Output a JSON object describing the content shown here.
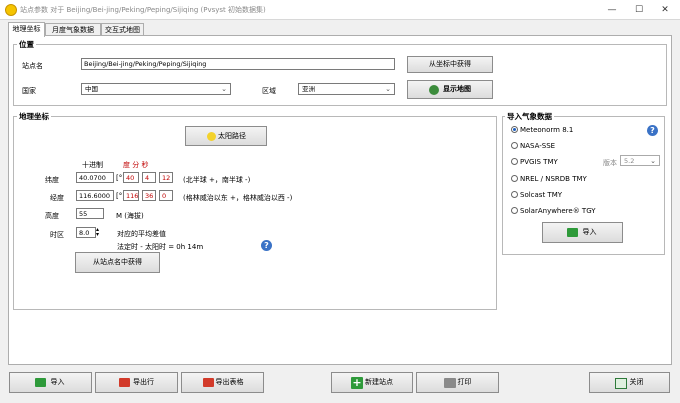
{
  "window": {
    "title": "站点参数 对于 Beijing/Bei-jing/Peking/Peping/Sijiqing (Pvsyst 初始数据集)",
    "minimize": "—",
    "maximize": "☐",
    "close": "✕"
  },
  "tabs": [
    {
      "label": "地理坐标",
      "active": true
    },
    {
      "label": "月度气象数据",
      "active": false
    },
    {
      "label": "交互式地图",
      "active": false
    }
  ],
  "location": {
    "group_title": "位置",
    "site_name_label": "站点名",
    "site_name_value": "Beijing/Bei-jing/Peking/Peping/Sijiqing",
    "from_coords_button": "从坐标中获得",
    "country_label": "国家",
    "country_value": "中国",
    "region_label": "区域",
    "region_value": "亚洲",
    "show_map_button": "显示地图"
  },
  "geo": {
    "group_title": "地理坐标",
    "sun_path_button": "太阳路径",
    "decimal_header": "十进制",
    "dms_header": "度 分 秒",
    "latitude_label": "纬度",
    "latitude_decimal": "40.0700",
    "latitude_unit": "[°]",
    "latitude_deg": "40",
    "latitude_min": "4",
    "latitude_sec": "12",
    "latitude_hint": "(北半球 +，南半球 -)",
    "longitude_label": "经度",
    "longitude_decimal": "116.6000",
    "longitude_unit": "[°]",
    "longitude_deg": "116",
    "longitude_min": "36",
    "longitude_sec": "0",
    "longitude_hint": "(格林威治以东 +，格林威治以西 -)",
    "altitude_label": "高度",
    "altitude_value": "55",
    "altitude_unit": "M (海拔)",
    "timezone_label": "时区",
    "timezone_value": "8.0",
    "timezone_note": "对应的平均差值",
    "legal_solar_diff": "法定时 - 太阳时 =   0h 14m",
    "from_site_button": "从站点名中获得"
  },
  "import_meteo": {
    "group_title": "导入气象数据",
    "options": [
      {
        "label": "Meteonorm 8.1",
        "checked": true
      },
      {
        "label": "NASA-SSE",
        "checked": false
      },
      {
        "label": "PVGIS TMY",
        "checked": false
      },
      {
        "label": "NREL / NSRDB TMY",
        "checked": false
      },
      {
        "label": "Solcast TMY",
        "checked": false
      },
      {
        "label": "SolarAnywhere® TGY",
        "checked": false
      }
    ],
    "version_label": "版本",
    "version_value": "5.2",
    "import_button": "导入"
  },
  "bottom": {
    "import": "导入",
    "export_row": "导出行",
    "export_table": "导出表格",
    "new_site": "新建站点",
    "print": "打印",
    "close": "关闭"
  },
  "colors": {
    "accent_blue": "#1e5fbf",
    "red_text": "#c00000",
    "green_icon": "#2e9a3a"
  }
}
